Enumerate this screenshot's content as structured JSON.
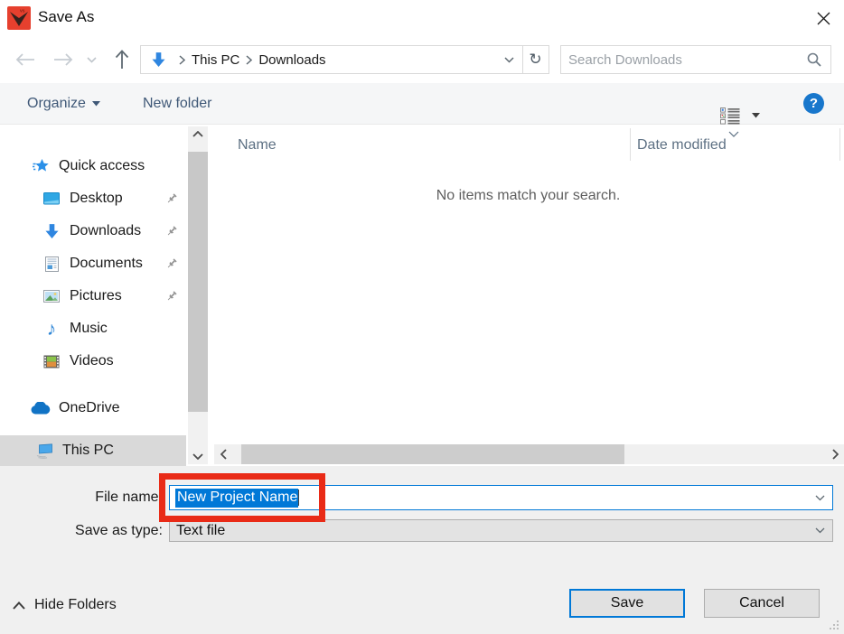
{
  "window": {
    "title": "Save As"
  },
  "navbar": {
    "breadcrumb": {
      "root": "This PC",
      "current": "Downloads"
    },
    "search": {
      "placeholder": "Search Downloads"
    },
    "refresh_glyph": "↻"
  },
  "toolbar": {
    "organize_label": "Organize",
    "new_folder_label": "New folder"
  },
  "sidebar": {
    "quick_access": "Quick access",
    "desktop": "Desktop",
    "downloads": "Downloads",
    "documents": "Documents",
    "pictures": "Pictures",
    "music": "Music",
    "videos": "Videos",
    "onedrive": "OneDrive",
    "this_pc": "This PC",
    "music_note_glyph": "♪"
  },
  "main": {
    "columns": {
      "name": "Name",
      "date_modified": "Date modified"
    },
    "empty_message": "No items match your search."
  },
  "footer": {
    "file_name_label": "File name:",
    "file_name_value": "New Project Name",
    "save_as_type_label": "Save as type:",
    "save_as_type_value": "Text file",
    "hide_folders_label": "Hide Folders",
    "save_label": "Save",
    "cancel_label": "Cancel"
  },
  "colors": {
    "accent": "#0078d7",
    "annotation_red": "#e92b17",
    "toolbar_text": "#3f5877",
    "header_text": "#5d7083"
  }
}
